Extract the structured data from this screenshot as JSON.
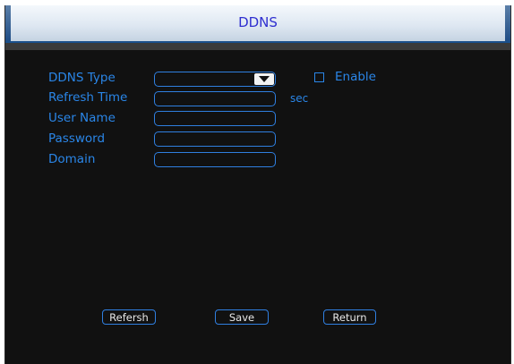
{
  "dialog": {
    "title": "DDNS"
  },
  "form": {
    "ddns_type_label": "DDNS Type",
    "ddns_type_value": "",
    "enable_label": "Enable",
    "enable_checked": false,
    "refresh_time_label": "Refresh Time",
    "refresh_time_value": "",
    "refresh_time_unit": "sec",
    "user_name_label": "User Name",
    "user_name_value": "",
    "password_label": "Password",
    "password_value": "",
    "domain_label": "Domain",
    "domain_value": ""
  },
  "buttons": {
    "refresh_label": "Refersh",
    "save_label": "Save",
    "return_label": "Return"
  },
  "colors": {
    "label": "#2a86e8",
    "field_border": "#2f7fe0",
    "title": "#2f2fd0",
    "background": "#111111"
  }
}
